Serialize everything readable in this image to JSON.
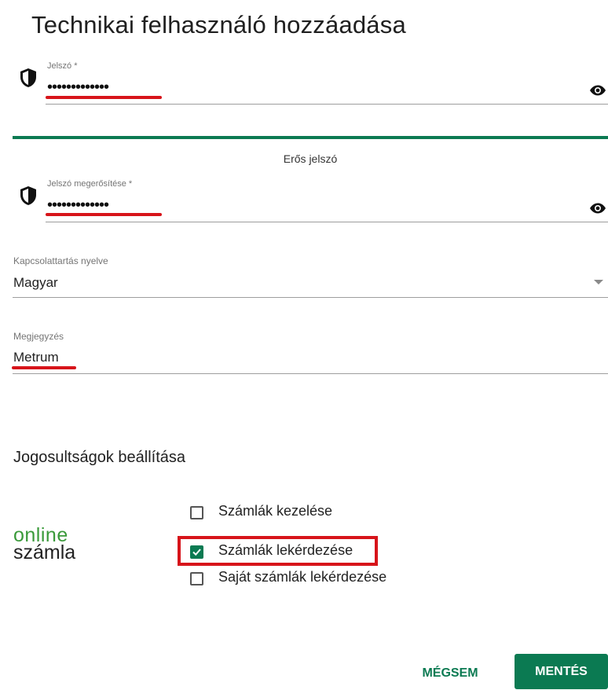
{
  "dialog": {
    "title": "Technikai felhasználó hozzáadása"
  },
  "password": {
    "label": "Jelszó *",
    "masked_value": "•••••••••••••",
    "icon": "shield-icon",
    "toggle_icon": "eye-icon"
  },
  "strength": {
    "text": "Erős jelszó",
    "color": "#0b7a52",
    "level": 1.0
  },
  "confirm_password": {
    "label": "Jelszó megerősítése *",
    "masked_value": "•••••••••••••",
    "icon": "shield-icon",
    "toggle_icon": "eye-icon"
  },
  "language": {
    "label": "Kapcsolattartás nyelve",
    "value": "Magyar"
  },
  "note": {
    "label": "Megjegyzés",
    "value": "Metrum"
  },
  "permissions": {
    "title": "Jogosultságok beállítása",
    "logo": {
      "line1": "online",
      "line2": "számla"
    },
    "options": [
      {
        "label": "Számlák kezelése",
        "checked": false
      },
      {
        "label": "Számlák lekérdezése",
        "checked": true
      },
      {
        "label": "Saját számlák lekérdezése",
        "checked": false
      }
    ]
  },
  "actions": {
    "cancel_label": "MÉGSEM",
    "save_label": "MENTÉS"
  },
  "colors": {
    "accent": "#0b7a52",
    "highlight": "#d7141a"
  }
}
